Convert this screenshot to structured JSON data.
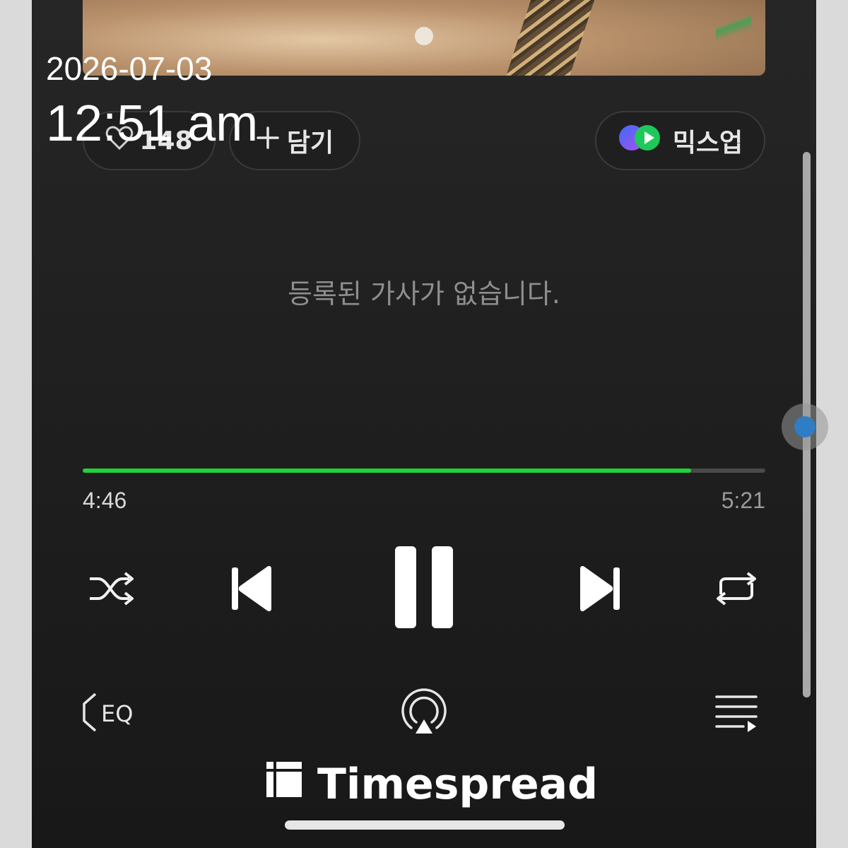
{
  "overlay": {
    "date": "2026-07-03",
    "time": "12:51 am"
  },
  "actions": {
    "like_count": "148",
    "add_label": "담기",
    "mixup_label": "믹스업"
  },
  "lyrics": {
    "empty_message": "등록된 가사가 없습니다."
  },
  "playback": {
    "current_time": "4:46",
    "total_time": "5:21",
    "progress_fraction": 0.891,
    "progress_color": "#22d13a",
    "state": "playing"
  },
  "controls": {
    "icons": [
      "shuffle-icon",
      "previous-icon",
      "pause-icon",
      "next-icon",
      "repeat-icon"
    ]
  },
  "bottom_tools": {
    "icons": [
      "eq-icon",
      "airplay-icon",
      "playlist-icon"
    ],
    "eq_label": "EQ"
  },
  "brand": {
    "name": "Timespread"
  }
}
